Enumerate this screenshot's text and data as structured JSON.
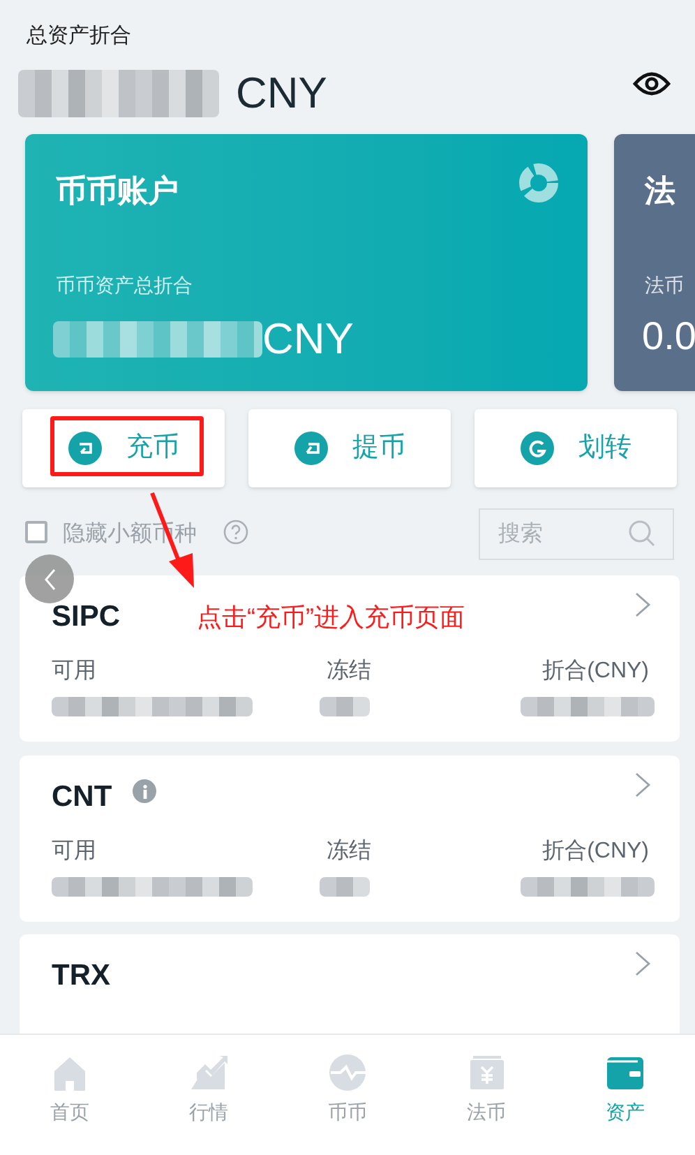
{
  "header": {
    "label": "总资产折合",
    "currency": "CNY"
  },
  "accounts": [
    {
      "kind": "spot",
      "title": "币币账户",
      "subtitle": "币币资产总折合",
      "value": "CNY"
    },
    {
      "kind": "fiat",
      "title": "法",
      "subtitle": "法币",
      "value": "0.0"
    }
  ],
  "actions": [
    {
      "kind": "deposit",
      "label": "充币",
      "highlighted": true
    },
    {
      "kind": "withdraw",
      "label": "提币",
      "highlighted": false
    },
    {
      "kind": "transfer",
      "label": "划转",
      "highlighted": false
    }
  ],
  "filter": {
    "label": "隐藏小额币种",
    "checked": false
  },
  "search": {
    "placeholder": "搜索"
  },
  "annotation": "点击“充币”进入充币页面",
  "assets": [
    {
      "name": "SIPC",
      "info": false,
      "labels": [
        "可用",
        "冻结",
        "折合(CNY)"
      ]
    },
    {
      "name": "CNT",
      "info": true,
      "labels": [
        "可用",
        "冻结",
        "折合(CNY)"
      ]
    },
    {
      "name": "TRX",
      "info": false
    }
  ],
  "nav": [
    {
      "kind": "home",
      "label": "首页",
      "selected": false
    },
    {
      "kind": "market",
      "label": "行情",
      "selected": false
    },
    {
      "kind": "spot",
      "label": "币币",
      "selected": false
    },
    {
      "kind": "fiat",
      "label": "法币",
      "selected": false
    },
    {
      "kind": "assets",
      "label": "资产",
      "selected": true
    }
  ]
}
